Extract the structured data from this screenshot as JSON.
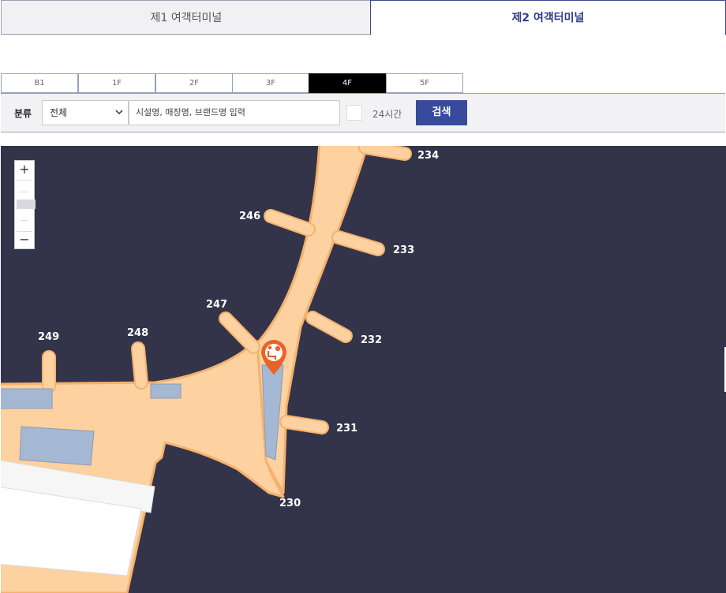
{
  "terminal_tabs": [
    {
      "label": "제1 여객터미널",
      "active": false
    },
    {
      "label": "제2 여객터미널",
      "active": true
    }
  ],
  "floors": [
    {
      "label": "B1",
      "active": false
    },
    {
      "label": "1F",
      "active": false
    },
    {
      "label": "2F",
      "active": false
    },
    {
      "label": "3F",
      "active": false
    },
    {
      "label": "4F",
      "active": true
    },
    {
      "label": "5F",
      "active": false
    }
  ],
  "filter": {
    "category_label": "분류",
    "category_value": "전체",
    "search_placeholder": "시설명, 매장명, 브랜드명 입력",
    "checkbox_label": "24시간",
    "search_button": "검색"
  },
  "map": {
    "gates": [
      "234",
      "246",
      "233",
      "247",
      "232",
      "249",
      "248",
      "231",
      "230"
    ],
    "marker_icon": "lounge-seat-icon",
    "zoom": {
      "in": "+",
      "out": "−"
    },
    "colors": {
      "background": "#33344a",
      "concourse": "#fdd1a0",
      "outline": "#f5b26d",
      "facility": "#a5b8d3",
      "marker": "#e8632a"
    }
  }
}
